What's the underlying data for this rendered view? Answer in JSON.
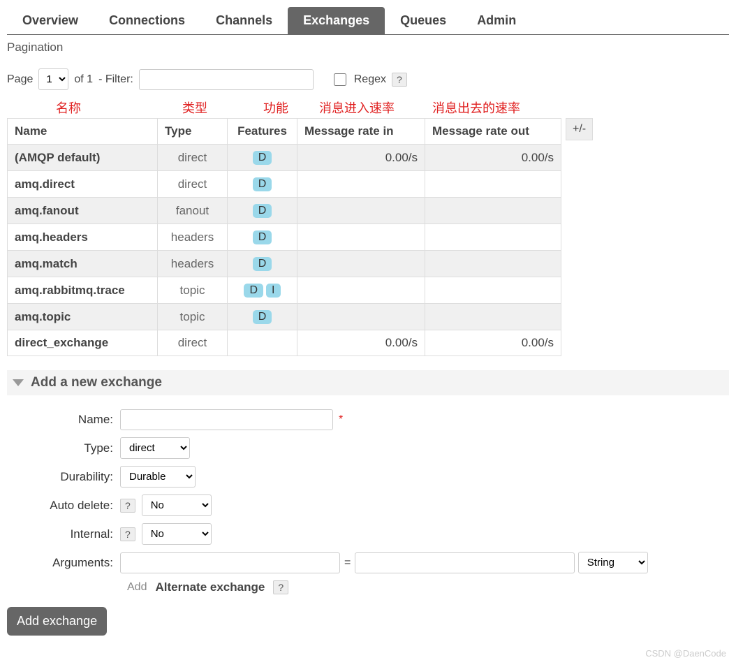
{
  "tabs": [
    "Overview",
    "Connections",
    "Channels",
    "Exchanges",
    "Queues",
    "Admin"
  ],
  "activeTab": "Exchanges",
  "paginationLabel": "Pagination",
  "pageLabel": "Page",
  "pageSelect": "1",
  "ofLabel": "of 1",
  "filterLabel": "- Filter:",
  "filterValue": "",
  "regexLabel": "Regex",
  "regexHelp": "?",
  "cn": {
    "name": "名称",
    "type": "类型",
    "feat": "功能",
    "in": "消息进入速率",
    "out": "消息出去的速率"
  },
  "columns": [
    "Name",
    "Type",
    "Features",
    "Message rate in",
    "Message rate out"
  ],
  "plusminus": "+/-",
  "rows": [
    {
      "name": "(AMQP default)",
      "type": "direct",
      "features": [
        "D"
      ],
      "in": "0.00/s",
      "out": "0.00/s"
    },
    {
      "name": "amq.direct",
      "type": "direct",
      "features": [
        "D"
      ],
      "in": "",
      "out": ""
    },
    {
      "name": "amq.fanout",
      "type": "fanout",
      "features": [
        "D"
      ],
      "in": "",
      "out": ""
    },
    {
      "name": "amq.headers",
      "type": "headers",
      "features": [
        "D"
      ],
      "in": "",
      "out": ""
    },
    {
      "name": "amq.match",
      "type": "headers",
      "features": [
        "D"
      ],
      "in": "",
      "out": ""
    },
    {
      "name": "amq.rabbitmq.trace",
      "type": "topic",
      "features": [
        "D",
        "I"
      ],
      "in": "",
      "out": ""
    },
    {
      "name": "amq.topic",
      "type": "topic",
      "features": [
        "D"
      ],
      "in": "",
      "out": ""
    },
    {
      "name": "direct_exchange",
      "type": "direct",
      "features": [],
      "in": "0.00/s",
      "out": "0.00/s"
    }
  ],
  "addSection": "Add a new exchange",
  "form": {
    "nameLabel": "Name:",
    "nameValue": "",
    "typeLabel": "Type:",
    "typeValue": "direct",
    "durLabel": "Durability:",
    "durValue": "Durable",
    "adLabel": "Auto delete:",
    "adHelp": "?",
    "adValue": "No",
    "intLabel": "Internal:",
    "intHelp": "?",
    "intValue": "No",
    "argsLabel": "Arguments:",
    "argKey": "",
    "argVal": "",
    "argType": "String",
    "eq": "=",
    "argAdd": "Add",
    "argAE": "Alternate exchange",
    "argAEHelp": "?",
    "submit": "Add exchange"
  },
  "watermark": "CSDN @DaenCode"
}
